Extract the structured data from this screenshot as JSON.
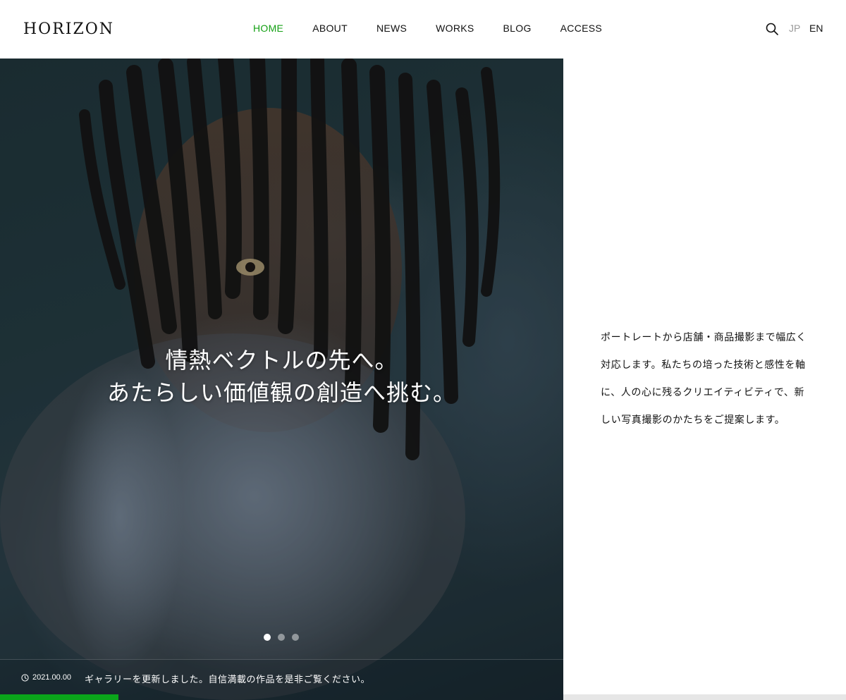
{
  "header": {
    "logo": "HORIZON",
    "nav": [
      {
        "label": "HOME",
        "active": true
      },
      {
        "label": "ABOUT",
        "active": false
      },
      {
        "label": "NEWS",
        "active": false
      },
      {
        "label": "WORKS",
        "active": false
      },
      {
        "label": "BLOG",
        "active": false
      },
      {
        "label": "ACCESS",
        "active": false
      }
    ],
    "search_icon": "search-icon",
    "lang_jp": "JP",
    "lang_en": "EN"
  },
  "hero": {
    "headline_line1": "情熱ベクトルの先へ。",
    "headline_line2": "あたらしい価値観の創造へ挑む。",
    "slides": 3,
    "active_slide": 1,
    "progress_fraction": 0.21
  },
  "news": {
    "icon": "clock-icon",
    "date": "2021.00.00",
    "text": "ギャラリーを更新しました。自信満載の作品を是非ご覧ください。"
  },
  "intro": {
    "lines": [
      "ポートレートから店舗・商品撮影まで幅広く",
      "対応します。私たちの培った技術と感性を軸",
      "に、人の心に残るクリエイティビティで、新",
      "しい写真撮影のかたちをご提案します。"
    ]
  },
  "colors": {
    "accent": "#14a014",
    "progress": "#0aa51a",
    "text": "#111111",
    "muted": "#9a9a9a"
  }
}
